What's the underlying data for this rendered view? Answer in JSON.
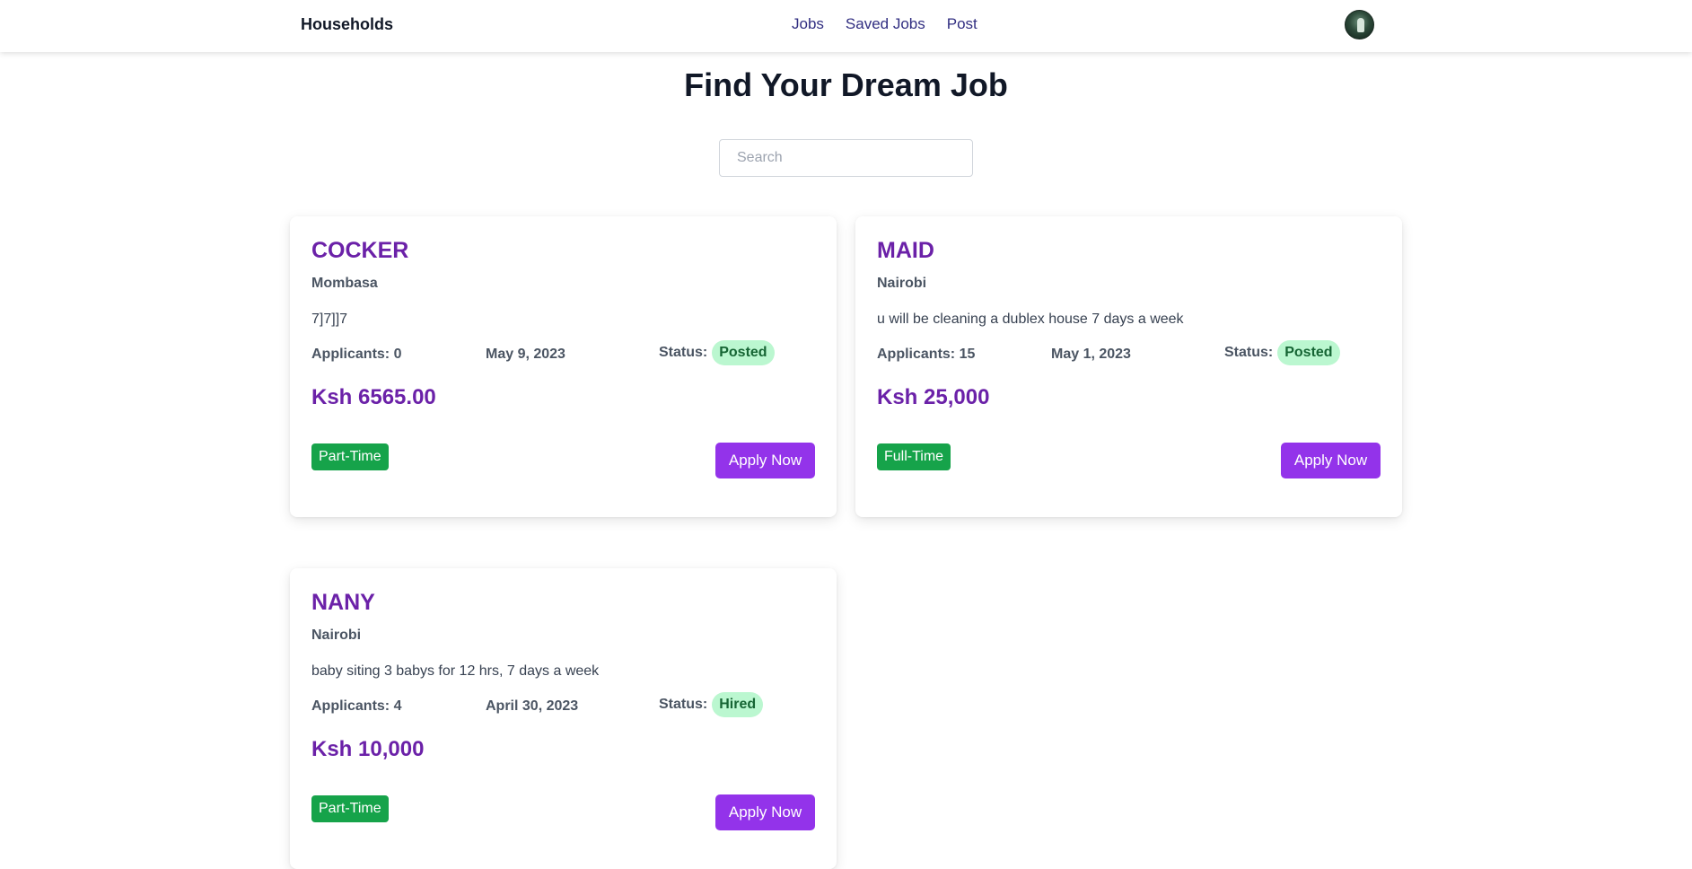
{
  "nav": {
    "brand": "Households",
    "links": [
      "Jobs",
      "Saved Jobs",
      "Post"
    ]
  },
  "page_title": "Find Your Dream Job",
  "search": {
    "placeholder": "Search",
    "value": ""
  },
  "jobs": [
    {
      "title": "COCKER",
      "location": "Mombasa",
      "description": "7]7]]7",
      "applicants": "Applicants: 0",
      "date": "May 9, 2023",
      "status_label": "Status:",
      "status": "Posted",
      "salary": "Ksh 6565.00",
      "type": "Part-Time",
      "apply_label": "Apply Now"
    },
    {
      "title": "MAID",
      "location": "Nairobi",
      "description": "u will be cleaning a dublex house 7 days a week",
      "applicants": "Applicants: 15",
      "date": "May 1, 2023",
      "status_label": "Status:",
      "status": "Posted",
      "salary": "Ksh 25,000",
      "type": "Full-Time",
      "apply_label": "Apply Now"
    },
    {
      "title": "NANY",
      "location": "Nairobi",
      "description": "baby siting 3 babys for 12 hrs, 7 days a week",
      "applicants": "Applicants: 4",
      "date": "April 30, 2023",
      "status_label": "Status:",
      "status": "Hired",
      "salary": "Ksh 10,000",
      "type": "Part-Time",
      "apply_label": "Apply Now"
    }
  ],
  "colors": {
    "accent": "#6b21a8",
    "button": "#9333ea",
    "status_bg": "#bbf7d0",
    "type_badge": "#16a34a"
  },
  "icons": {
    "avatar": "user-avatar"
  }
}
